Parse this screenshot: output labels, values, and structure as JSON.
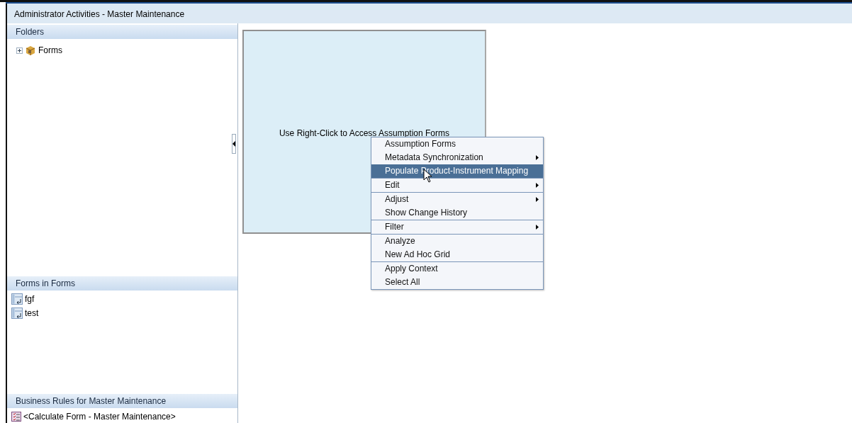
{
  "window": {
    "title": "Administrator Activities - Master Maintenance"
  },
  "folders": {
    "title": "Folders",
    "items": [
      {
        "label": "Forms",
        "expanded": false
      }
    ]
  },
  "forms_panel": {
    "title": "Forms in Forms",
    "items": [
      {
        "label": "fgf"
      },
      {
        "label": "test"
      }
    ]
  },
  "rules_panel": {
    "title": "Business Rules for Master Maintenance",
    "items": [
      {
        "label": "<Calculate Form - Master Maintenance>"
      }
    ]
  },
  "canvas": {
    "hint": "Use Right-Click to Access Assumption Forms"
  },
  "context_menu": {
    "groups": [
      [
        {
          "label": "Assumption Forms",
          "submenu": false,
          "selected": false
        },
        {
          "label": "Metadata Synchronization",
          "submenu": true,
          "selected": false
        },
        {
          "label": "Populate Product-Instrument Mapping",
          "submenu": false,
          "selected": true
        }
      ],
      [
        {
          "label": "Edit",
          "submenu": true,
          "selected": false
        }
      ],
      [
        {
          "label": "Adjust",
          "submenu": true,
          "selected": false
        },
        {
          "label": "Show Change History",
          "submenu": false,
          "selected": false
        }
      ],
      [
        {
          "label": "Filter",
          "submenu": true,
          "selected": false
        }
      ],
      [
        {
          "label": "Analyze",
          "submenu": false,
          "selected": false
        },
        {
          "label": "New Ad Hoc Grid",
          "submenu": false,
          "selected": false
        }
      ],
      [
        {
          "label": "Apply Context",
          "submenu": false,
          "selected": false
        },
        {
          "label": "Select All",
          "submenu": false,
          "selected": false
        }
      ]
    ]
  }
}
